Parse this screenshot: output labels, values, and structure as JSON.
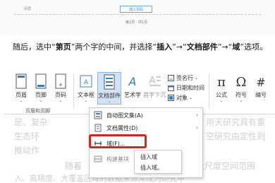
{
  "doc_header": {
    "left_label": "页眉",
    "box_label": "插入页码",
    "sub_label": "第1页 · 共1页"
  },
  "instruction": {
    "p1": "随后，选中“",
    "k1": "第页",
    "p2": "”两个字的中间，并选择“",
    "k2": "插入",
    "p3": "”→“",
    "k3": "文档部件",
    "p4": "”→“",
    "k4": "域",
    "p5": "”选项。"
  },
  "ribbon": {
    "buttons": [
      {
        "label": "页眉",
        "icon": "header-icon"
      },
      {
        "label": "页脚",
        "icon": "footer-icon"
      },
      {
        "label": "页码",
        "icon": "page-number-icon"
      },
      {
        "label": "文本框",
        "icon": "textbox-icon"
      },
      {
        "label": "文档部件",
        "icon": "quick-parts-icon"
      },
      {
        "label": "艺术字",
        "icon": "wordart-icon"
      },
      {
        "label": "首字下沉",
        "icon": "dropcap-icon"
      },
      {
        "label": "公式",
        "icon": "equation-icon"
      },
      {
        "label": "符号",
        "icon": "symbol-icon"
      },
      {
        "label": "编号",
        "icon": "number-icon"
      }
    ],
    "small_items": {
      "signature": "签名行",
      "datetime": "日期和时间",
      "object": "对象"
    },
    "group_header_footer": "页眉和页脚"
  },
  "menu": {
    "items": [
      {
        "label": "自动图文集(A)",
        "has_arrow": true
      },
      {
        "label": "文档属性(D)",
        "has_arrow": true
      },
      {
        "label": "域(F)...",
        "has_arrow": false
      },
      {
        "label": "构建基块",
        "has_arrow": false
      }
    ]
  },
  "submenu": {
    "items": [
      "插入域",
      "插入域。"
    ]
  },
  "bg_doc": {
    "line1": "是、复杂",
    "line1r": "用天研究具有重",
    "line2": "生态环",
    "line2r": "空研究由定性到",
    "line3": "推动作",
    "line4": "随着",
    "line4r": "大尺度空间范围",
    "line5": "入、高精度、大覆盖区域的数据来源渐成为研究中"
  }
}
